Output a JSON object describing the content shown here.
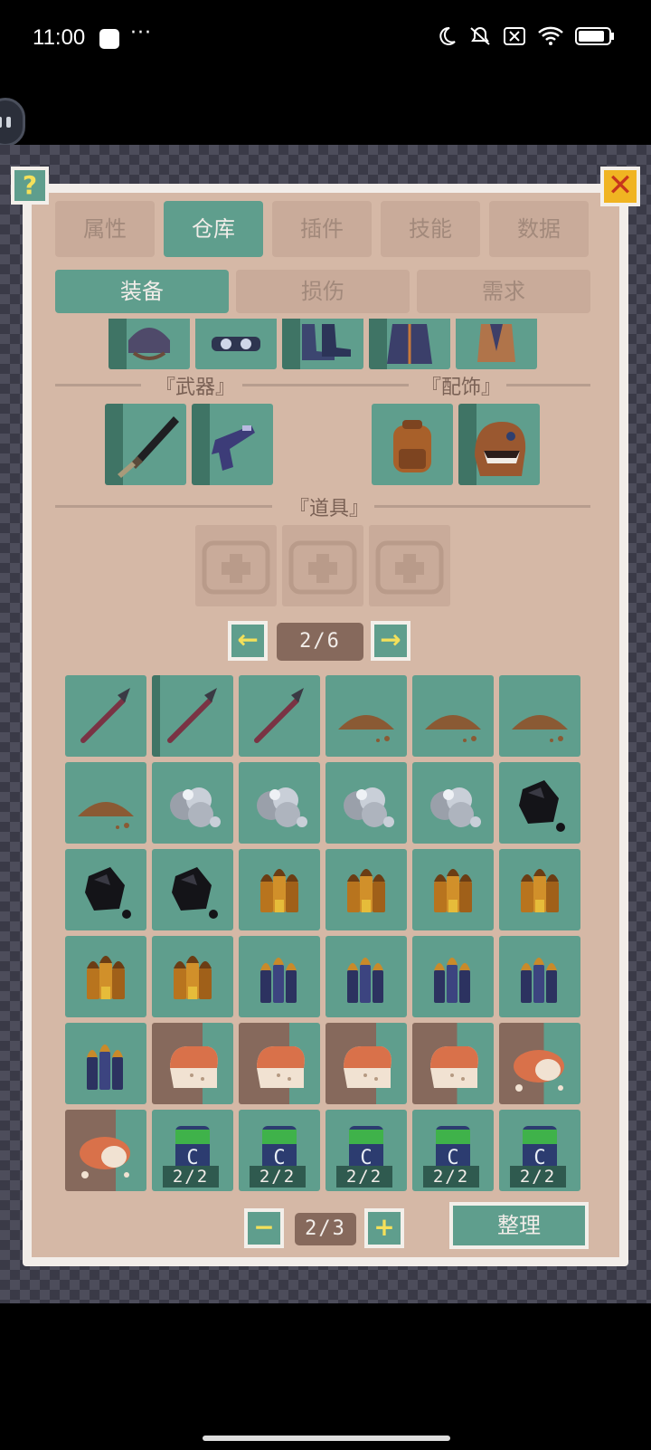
{
  "status_bar": {
    "time": "11:00",
    "icons": [
      "moon-icon",
      "mute-icon",
      "sim-off-icon",
      "wifi-icon",
      "battery-icon"
    ]
  },
  "main_tabs": [
    {
      "label": "属性",
      "active": false
    },
    {
      "label": "仓库",
      "active": true
    },
    {
      "label": "插件",
      "active": false
    },
    {
      "label": "技能",
      "active": false
    },
    {
      "label": "数据",
      "active": false
    }
  ],
  "sub_tabs": [
    {
      "label": "装备",
      "active": true
    },
    {
      "label": "损伤",
      "active": false
    },
    {
      "label": "需求",
      "active": false
    }
  ],
  "help_label": "?",
  "close_label": "✕",
  "sections": {
    "weapons": "『武器』",
    "accessories": "『配饰』",
    "items": "『道具』"
  },
  "armor_slots": [
    "helmet",
    "goggles",
    "boots",
    "coat",
    "vest"
  ],
  "weapon_slots": [
    "sword",
    "pistol"
  ],
  "accessory_slots": [
    "backpack",
    "beast-head-bag"
  ],
  "item_slots": [
    "empty-medkit",
    "empty-medkit",
    "empty-medkit"
  ],
  "page_pager": {
    "label": "2/6",
    "prev": "←",
    "next": "→"
  },
  "inventory": [
    {
      "item": "spear",
      "style": "normal"
    },
    {
      "item": "spear",
      "style": "dark"
    },
    {
      "item": "spear",
      "style": "normal"
    },
    {
      "item": "dirt-pile",
      "style": "normal"
    },
    {
      "item": "dirt-pile",
      "style": "normal"
    },
    {
      "item": "dirt-pile",
      "style": "normal"
    },
    {
      "item": "dirt-pile",
      "style": "normal"
    },
    {
      "item": "iron-ore",
      "style": "normal"
    },
    {
      "item": "iron-ore",
      "style": "normal"
    },
    {
      "item": "iron-ore",
      "style": "normal"
    },
    {
      "item": "iron-ore",
      "style": "normal"
    },
    {
      "item": "coal",
      "style": "normal"
    },
    {
      "item": "coal",
      "style": "normal"
    },
    {
      "item": "coal",
      "style": "normal"
    },
    {
      "item": "bronze-bullets",
      "style": "normal"
    },
    {
      "item": "bronze-bullets",
      "style": "normal"
    },
    {
      "item": "bronze-bullets",
      "style": "normal"
    },
    {
      "item": "bronze-bullets",
      "style": "normal"
    },
    {
      "item": "bronze-bullets",
      "style": "normal"
    },
    {
      "item": "bronze-bullets",
      "style": "normal"
    },
    {
      "item": "blue-bullets",
      "style": "normal"
    },
    {
      "item": "blue-bullets",
      "style": "normal"
    },
    {
      "item": "blue-bullets",
      "style": "normal"
    },
    {
      "item": "blue-bullets",
      "style": "normal"
    },
    {
      "item": "blue-bullets",
      "style": "normal"
    },
    {
      "item": "bread",
      "style": "brown"
    },
    {
      "item": "bread",
      "style": "brown"
    },
    {
      "item": "bread",
      "style": "brown"
    },
    {
      "item": "bread",
      "style": "brownl"
    },
    {
      "item": "bread-roll",
      "style": "brownl"
    },
    {
      "item": "bread-roll",
      "style": "brown"
    },
    {
      "item": "energy-can",
      "style": "normal",
      "count": "2/2"
    },
    {
      "item": "energy-can",
      "style": "normal",
      "count": "2/2"
    },
    {
      "item": "energy-can",
      "style": "normal",
      "count": "2/2"
    },
    {
      "item": "energy-can",
      "style": "normal",
      "count": "2/2"
    },
    {
      "item": "energy-can",
      "style": "normal",
      "count": "2/2"
    }
  ],
  "bottom_pager": {
    "label": "2/3",
    "minus": "−",
    "plus": "+"
  },
  "sort_label": "整理",
  "colors": {
    "slot": "#5f9e8d",
    "panel": "#d5b8a6",
    "accent": "#f4e05a",
    "close": "#f0b422"
  }
}
